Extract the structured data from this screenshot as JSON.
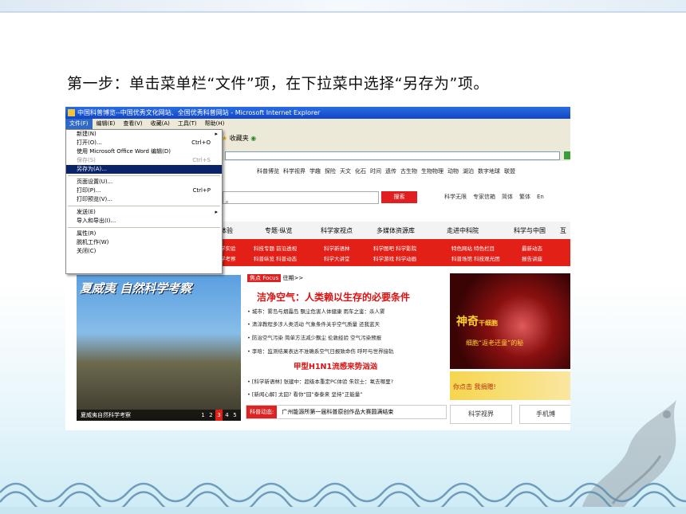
{
  "slide": {
    "heading": "第一步：单击菜单栏“文件”项，在下拉菜中选择“另存为”项。"
  },
  "browser": {
    "title": "中国科普博览--中国优秀文化网站、全国优秀科普网站 - Microsoft Internet Explorer",
    "menubar": [
      "文件(F)",
      "编辑(E)",
      "查看(V)",
      "收藏(A)",
      "工具(T)",
      "帮助(H)"
    ],
    "toolbar_favorites": "收藏夹"
  },
  "file_menu": {
    "items": [
      {
        "label": "新建(N)",
        "arrow": "▸"
      },
      {
        "label": "打开(O)...",
        "shortcut": "Ctrl+O"
      },
      {
        "label": "使用 Microsoft Office Word 编辑(D)"
      },
      {
        "label": "保存(S)",
        "shortcut": "Ctrl+S",
        "disabled": true
      },
      {
        "label": "另存为(A)...",
        "selected": true
      },
      {
        "label": "页面设置(U)..."
      },
      {
        "label": "打印(P)...",
        "shortcut": "Ctrl+P"
      },
      {
        "label": "打印预览(V)..."
      },
      {
        "label": "发送(E)",
        "arrow": "▸"
      },
      {
        "label": "导入和导出(I)..."
      },
      {
        "label": "属性(R)"
      },
      {
        "label": "脱机工作(W)"
      },
      {
        "label": "关闭(C)"
      }
    ]
  },
  "site": {
    "nav_links": [
      "科普博览",
      "科学视界",
      "学趣",
      "探险",
      "天文",
      "化石",
      "时间",
      "遗传",
      "古生物",
      "生物物理",
      "动物",
      "湖泊",
      "数字地球",
      "联盟"
    ],
    "search_button": "搜索",
    "top_links": [
      "科学无限",
      "专家信箱",
      "简体",
      "繁体",
      "En"
    ],
    "tabs": [
      "体验",
      "专题·纵览",
      "科学家视点",
      "多媒体资源库",
      "走进中科院",
      "科学与中国",
      "互"
    ],
    "red_links": [
      [
        "学实验",
        "学考察"
      ],
      [
        "科技专题 前沿透视",
        "科普纵览 科普动态"
      ],
      [
        "科学新语林",
        "科学大讲堂"
      ],
      [
        "科学图吧 科学影院",
        "科学游戏 科学动画"
      ],
      [
        "特色网站 特色栏目",
        "科普场馆 科技观光团"
      ],
      [
        "最新动态",
        "报告讲座"
      ]
    ],
    "banner_title": "夏威夷 自然科学考察",
    "banner_caption": "夏威夷自然科学考察",
    "banner_pages": [
      "1",
      "2",
      "3",
      "4",
      "5"
    ],
    "focus_tag": "焦点 Focus",
    "focus_more": "往期>>",
    "headline": "洁净空气：人类赖以生存的必要条件",
    "news_lines": [
      "• 城市：雾岛与烟霾岛    飘尘危害人体健康    雨车之鉴：杀人雾",
      "• 清淳教程多涉人类活动     气象条件关乎空气质量      还我蓝天",
      "• 防治空气污染     简单方法减少飘尘     伦敦经验     空气污染预报",
      "• 李晗：监测结果表达不准确系空气日报致命伤     呼吁与世界接轨"
    ],
    "subhead": "甲型H1N1流感来势汹汹",
    "news_lines2": [
      "• [科学新语林]  张建中：超级本重定PC体验     朱钦士：氧去哪里?",
      "• [新闻心解]  太囧? 看你“囧”泰泰来      坚持“正能量”"
    ],
    "newsbar_label": "科普动态:",
    "newsbar_text": "广州能源所第一届科普原创作品大赛圆满结束",
    "right_big": "神奇",
    "right_small": "干细胞",
    "right_sub": "细胞“返老还童”的秘",
    "right_ad": "你点击 我捐赠!",
    "bottom_btn1": "科学视界",
    "bottom_btn2": "手机博"
  }
}
